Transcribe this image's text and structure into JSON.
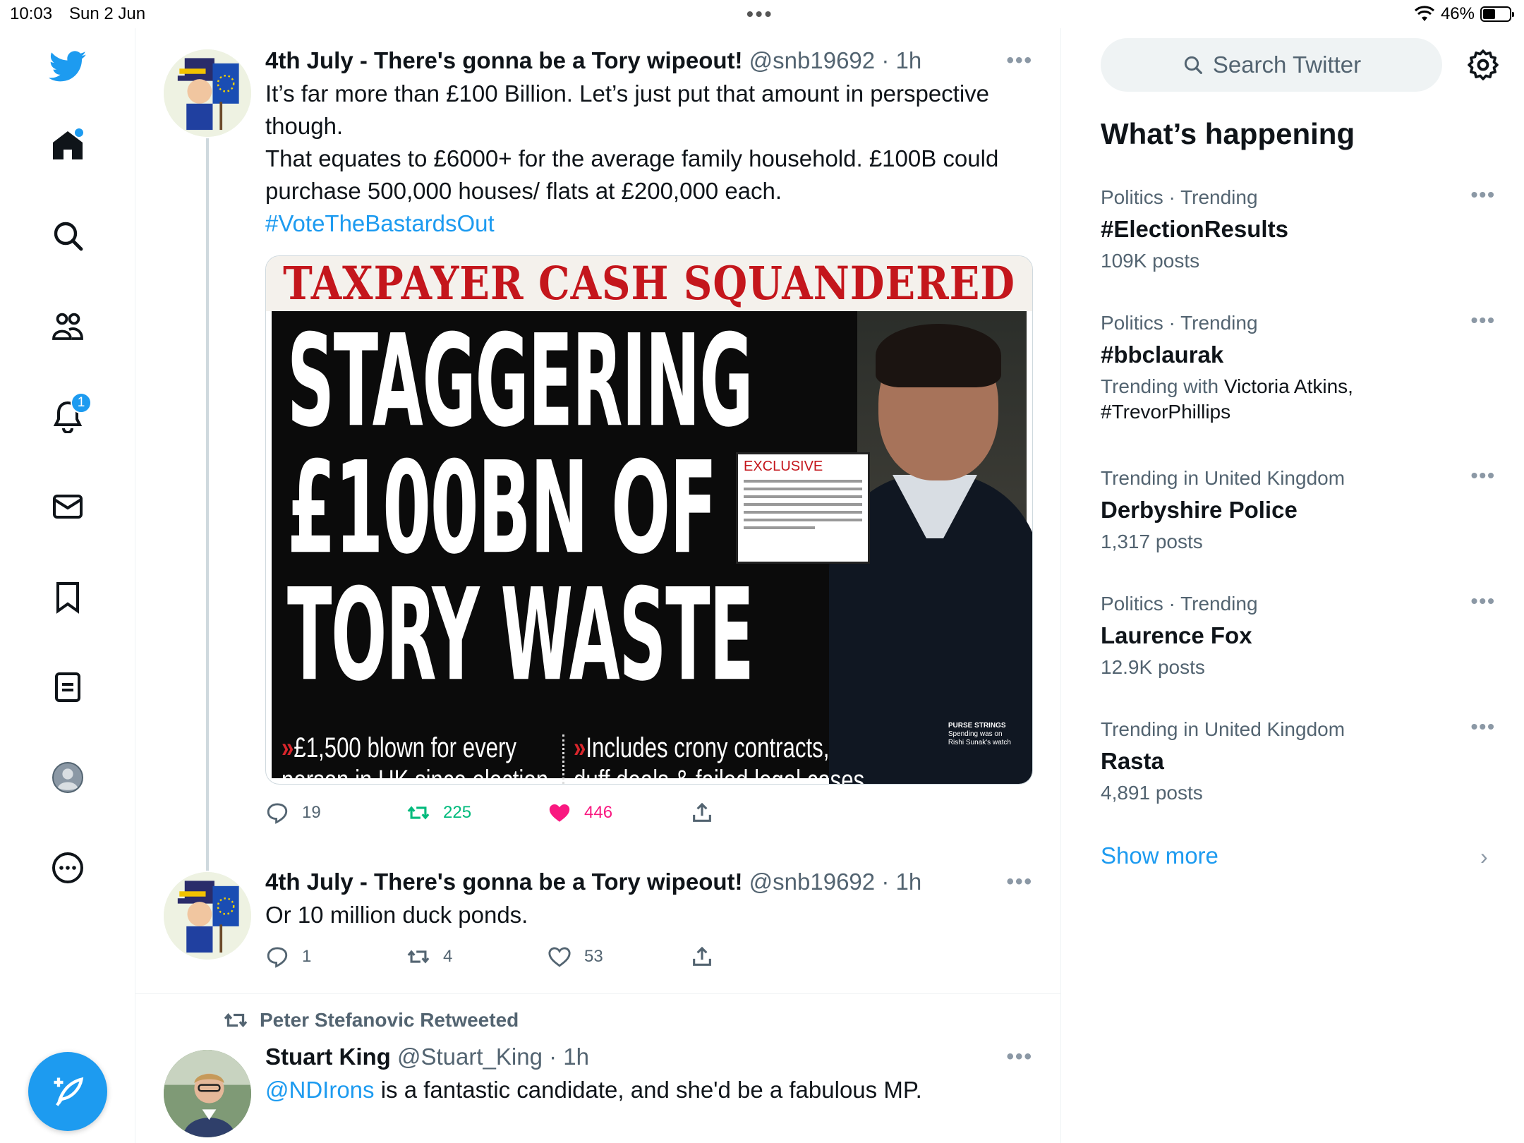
{
  "status_bar": {
    "time": "10:03",
    "date": "Sun 2 Jun",
    "battery": "46%",
    "battery_level": 0.46
  },
  "nav": {
    "notifications_badge": "1"
  },
  "tweets": [
    {
      "name": "4th July - There's gonna be a Tory wipeout!",
      "handle": "@snb19692",
      "time": "· 1h",
      "text": "It’s far more than £100 Billion. Let’s just put that amount in perspective though.\nThat equates to £6000+ for the average family household. £100B could purchase 500,000 houses/ flats at £200,000 each.",
      "hashtag": "#VoteTheBastardsOut",
      "replies": "19",
      "retweets": "225",
      "likes": "446",
      "liked": true
    },
    {
      "name": "4th July - There's gonna be a Tory wipeout!",
      "handle": "@snb19692",
      "time": "· 1h",
      "text": "Or 10 million duck ponds.",
      "replies": "1",
      "retweets": "4",
      "likes": "53"
    },
    {
      "retweeted_by": "Peter Stefanovic Retweeted",
      "name": "Stuart King",
      "handle": "@Stuart_King",
      "time": "· 1h",
      "mention": "@NDIrons",
      "text": " is a fantastic candidate, and she'd be a fabulous MP."
    }
  ],
  "newspaper": {
    "banner": "TAXPAYER CASH SQUANDERED",
    "line1": "STAGGERING",
    "line2": "£100BN OF",
    "line3": "TORY WASTE",
    "exclusive": "EXCLUSIVE",
    "sub_left_1": "£1,500 blown for every",
    "sub_left_2": "person in UK since election",
    "sub_right_1": "Includes crony contracts,",
    "sub_right_2": "duff deals & failed legal cases",
    "purse_1": "PURSE STRINGS",
    "purse_2": "Spending was on",
    "purse_3": "Rishi Sunak's watch"
  },
  "sidebar": {
    "search_placeholder": "Search Twitter",
    "title": "What’s happening",
    "trends": [
      {
        "category": "Politics · Trending",
        "name": "#ElectionResults",
        "posts": "109K posts"
      },
      {
        "category": "Politics · Trending",
        "name": "#bbclaurak",
        "with_label": "Trending with ",
        "with_1": "Victoria Atkins,",
        "with_2": "#TrevorPhillips"
      },
      {
        "category": "Trending in United Kingdom",
        "name": "Derbyshire Police",
        "posts": "1,317 posts"
      },
      {
        "category": "Politics · Trending",
        "name": "Laurence Fox",
        "posts": "12.9K posts"
      },
      {
        "category": "Trending in United Kingdom",
        "name": "Rasta",
        "posts": "4,891 posts"
      }
    ],
    "show_more": "Show more"
  },
  "colors": {
    "accent": "#1d9bf0",
    "retweet": "#00ba7c",
    "like": "#f91880",
    "secondary_text": "#536471"
  }
}
